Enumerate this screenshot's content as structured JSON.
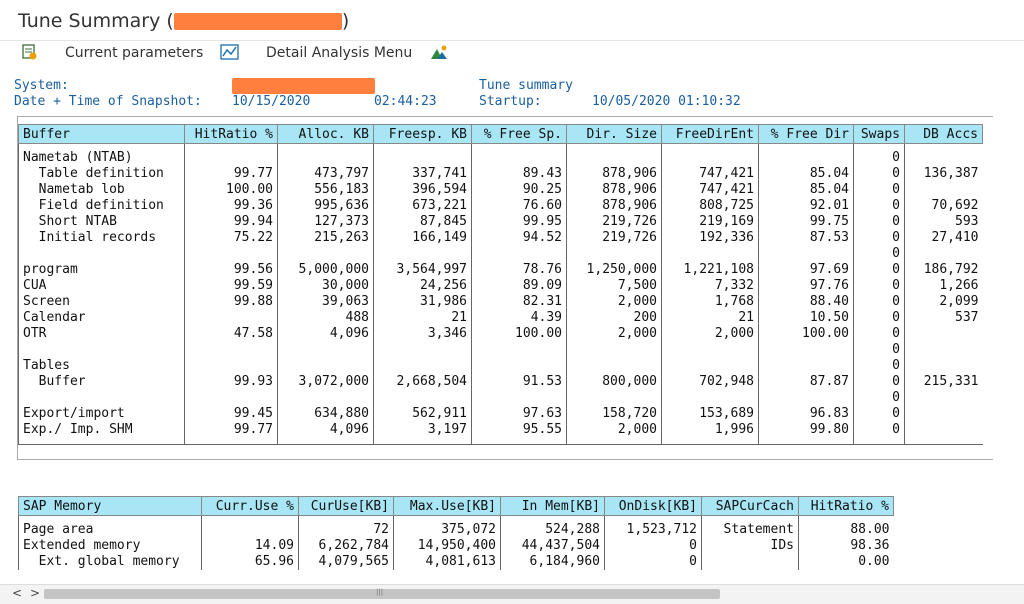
{
  "window": {
    "title": "Tune Summary",
    "open_paren": "(",
    "close_paren": ")"
  },
  "toolbar": {
    "current_parameters": "Current parameters",
    "detail_analysis_menu": "Detail Analysis Menu"
  },
  "header": {
    "system_label": "System:",
    "datetime_label": "Date + Time of Snapshot:",
    "snapshot_date": "10/15/2020",
    "snapshot_time": "02:44:23",
    "tune_summary": "Tune summary",
    "startup_label": "Startup:",
    "startup_value": "10/05/2020 01:10:32"
  },
  "buffer_table": {
    "columns": [
      "Buffer",
      "HitRatio %",
      "Alloc. KB",
      "Freesp. KB",
      "% Free Sp.",
      "Dir. Size",
      "FreeDirEnt",
      "% Free Dir",
      "Swaps",
      "DB Accs"
    ],
    "rows": [
      [
        "Nametab (NTAB)",
        "",
        "",
        "",
        "",
        "",
        "",
        "",
        "0",
        ""
      ],
      [
        "  Table definition",
        "99.77",
        "473,797",
        "337,741",
        "89.43",
        "878,906",
        "747,421",
        "85.04",
        "0",
        "136,387"
      ],
      [
        "  Nametab lob",
        "100.00",
        "556,183",
        "396,594",
        "90.25",
        "878,906",
        "747,421",
        "85.04",
        "0",
        ""
      ],
      [
        "  Field definition",
        "99.36",
        "995,636",
        "673,221",
        "76.60",
        "878,906",
        "808,725",
        "92.01",
        "0",
        "70,692"
      ],
      [
        "  Short NTAB",
        "99.94",
        "127,373",
        "87,845",
        "99.95",
        "219,726",
        "219,169",
        "99.75",
        "0",
        "593"
      ],
      [
        "  Initial records",
        "75.22",
        "215,263",
        "166,149",
        "94.52",
        "219,726",
        "192,336",
        "87.53",
        "0",
        "27,410"
      ],
      [
        "",
        "",
        "",
        "",
        "",
        "",
        "",
        "",
        "0",
        ""
      ],
      [
        "program",
        "99.56",
        "5,000,000",
        "3,564,997",
        "78.76",
        "1,250,000",
        "1,221,108",
        "97.69",
        "0",
        "186,792"
      ],
      [
        "CUA",
        "99.59",
        "30,000",
        "24,256",
        "89.09",
        "7,500",
        "7,332",
        "97.76",
        "0",
        "1,266"
      ],
      [
        "Screen",
        "99.88",
        "39,063",
        "31,986",
        "82.31",
        "2,000",
        "1,768",
        "88.40",
        "0",
        "2,099"
      ],
      [
        "Calendar",
        "",
        "488",
        "21",
        "4.39",
        "200",
        "21",
        "10.50",
        "0",
        "537"
      ],
      [
        "OTR",
        "47.58",
        "4,096",
        "3,346",
        "100.00",
        "2,000",
        "2,000",
        "100.00",
        "0",
        ""
      ],
      [
        "",
        "",
        "",
        "",
        "",
        "",
        "",
        "",
        "0",
        ""
      ],
      [
        "Tables",
        "",
        "",
        "",
        "",
        "",
        "",
        "",
        "0",
        ""
      ],
      [
        "  Buffer",
        "99.93",
        "3,072,000",
        "2,668,504",
        "91.53",
        "800,000",
        "702,948",
        "87.87",
        "0",
        "215,331"
      ],
      [
        "",
        "",
        "",
        "",
        "",
        "",
        "",
        "",
        "0",
        ""
      ],
      [
        "Export/import",
        "99.45",
        "634,880",
        "562,911",
        "97.63",
        "158,720",
        "153,689",
        "96.83",
        "0",
        ""
      ],
      [
        "Exp./ Imp. SHM",
        "99.77",
        "4,096",
        "3,197",
        "95.55",
        "2,000",
        "1,996",
        "99.80",
        "0",
        ""
      ]
    ]
  },
  "memory_table": {
    "columns": [
      "SAP Memory",
      "Curr.Use %",
      "CurUse[KB]",
      "Max.Use[KB]",
      "In Mem[KB]",
      "OnDisk[KB]",
      "SAPCurCach",
      "HitRatio %"
    ],
    "rows": [
      [
        "Page area",
        "",
        "72",
        "375,072",
        "524,288",
        "1,523,712",
        "Statement",
        "88.00"
      ],
      [
        "Extended memory",
        "14.09",
        "6,262,784",
        "14,950,400",
        "44,437,504",
        "0",
        "IDs",
        "98.36"
      ],
      [
        "  Ext. global memory",
        "65.96",
        "4,079,565",
        "4,081,613",
        "6,184,960",
        "0",
        "",
        "0.00"
      ]
    ]
  },
  "scrollbar": {
    "left_arrow": "<",
    "right_arrow": ">",
    "grip": "|||"
  },
  "colors": {
    "header_fill": "#a8e6f6",
    "redaction": "#ff7f3f",
    "info_text": "#1a5fa0"
  }
}
